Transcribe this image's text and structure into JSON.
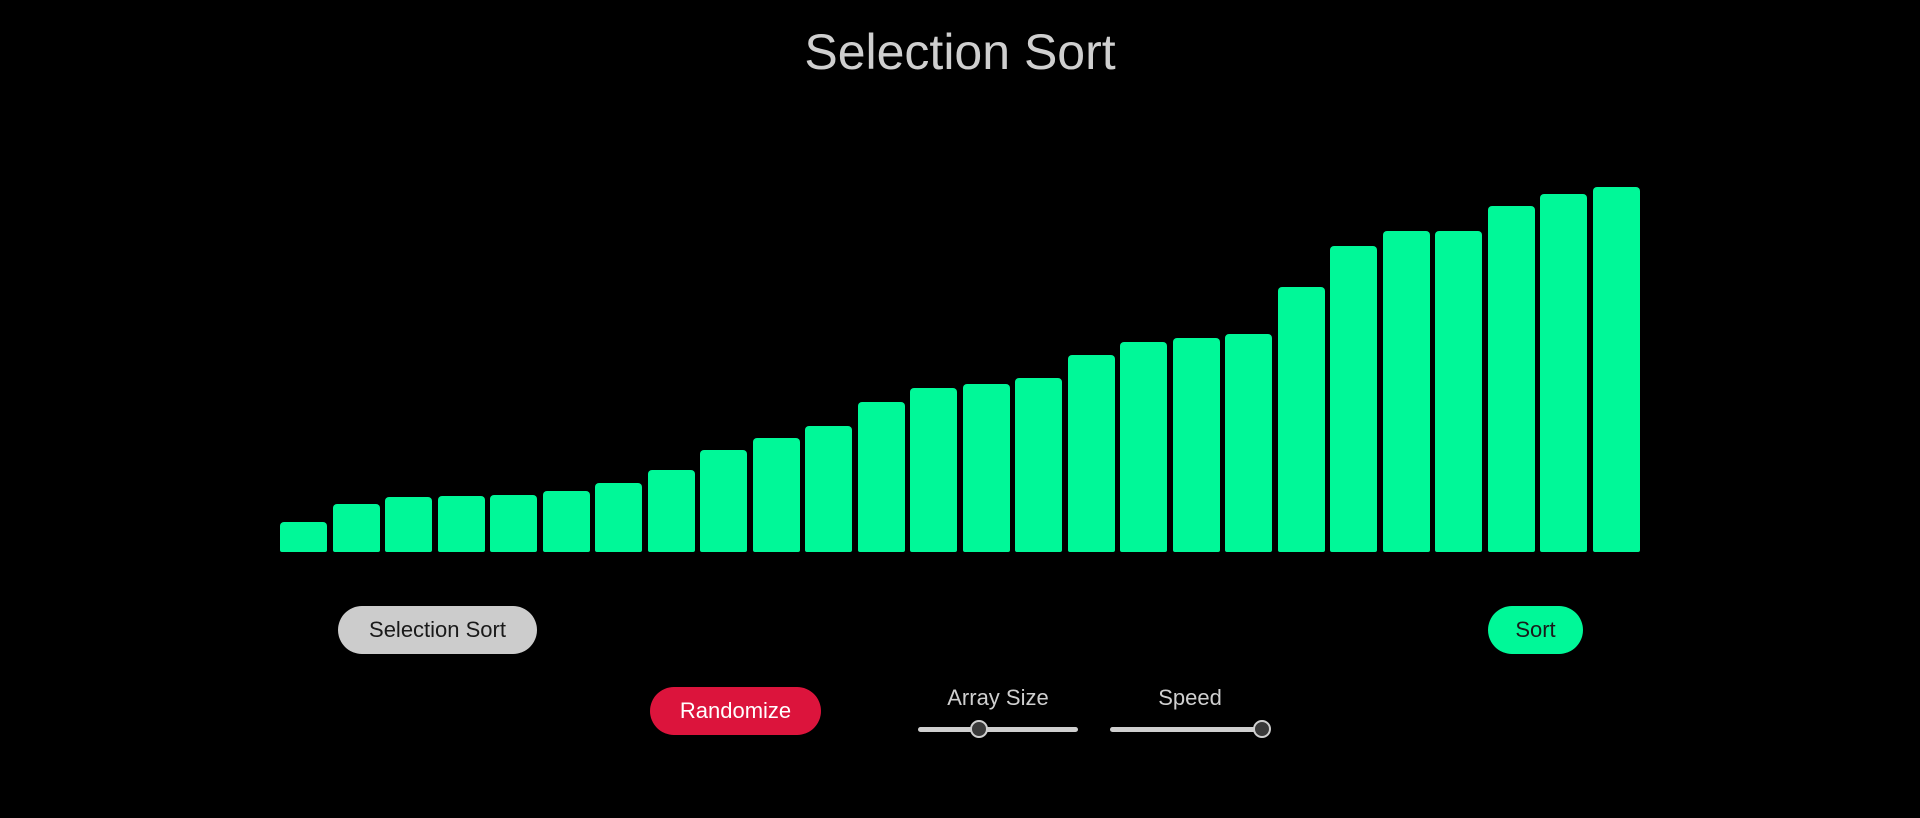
{
  "title": "Selection Sort",
  "bar_color": "#00f898",
  "bar_values": [
    30,
    48,
    55,
    56,
    57,
    61,
    69,
    82,
    102,
    114,
    126,
    150,
    164,
    168,
    174,
    197,
    210,
    214,
    218,
    265,
    306,
    321,
    321,
    346,
    358,
    365
  ],
  "buttons": {
    "algorithm_label": "Selection Sort",
    "sort_label": "Sort",
    "randomize_label": "Randomize"
  },
  "controls": {
    "array_size_label": "Array Size",
    "array_size_fraction": 0.38,
    "speed_label": "Speed",
    "speed_fraction": 0.95
  },
  "colors": {
    "background": "#000000",
    "accent": "#00f898",
    "randomize": "#dc143c",
    "algorithm_button": "#cccccc"
  }
}
